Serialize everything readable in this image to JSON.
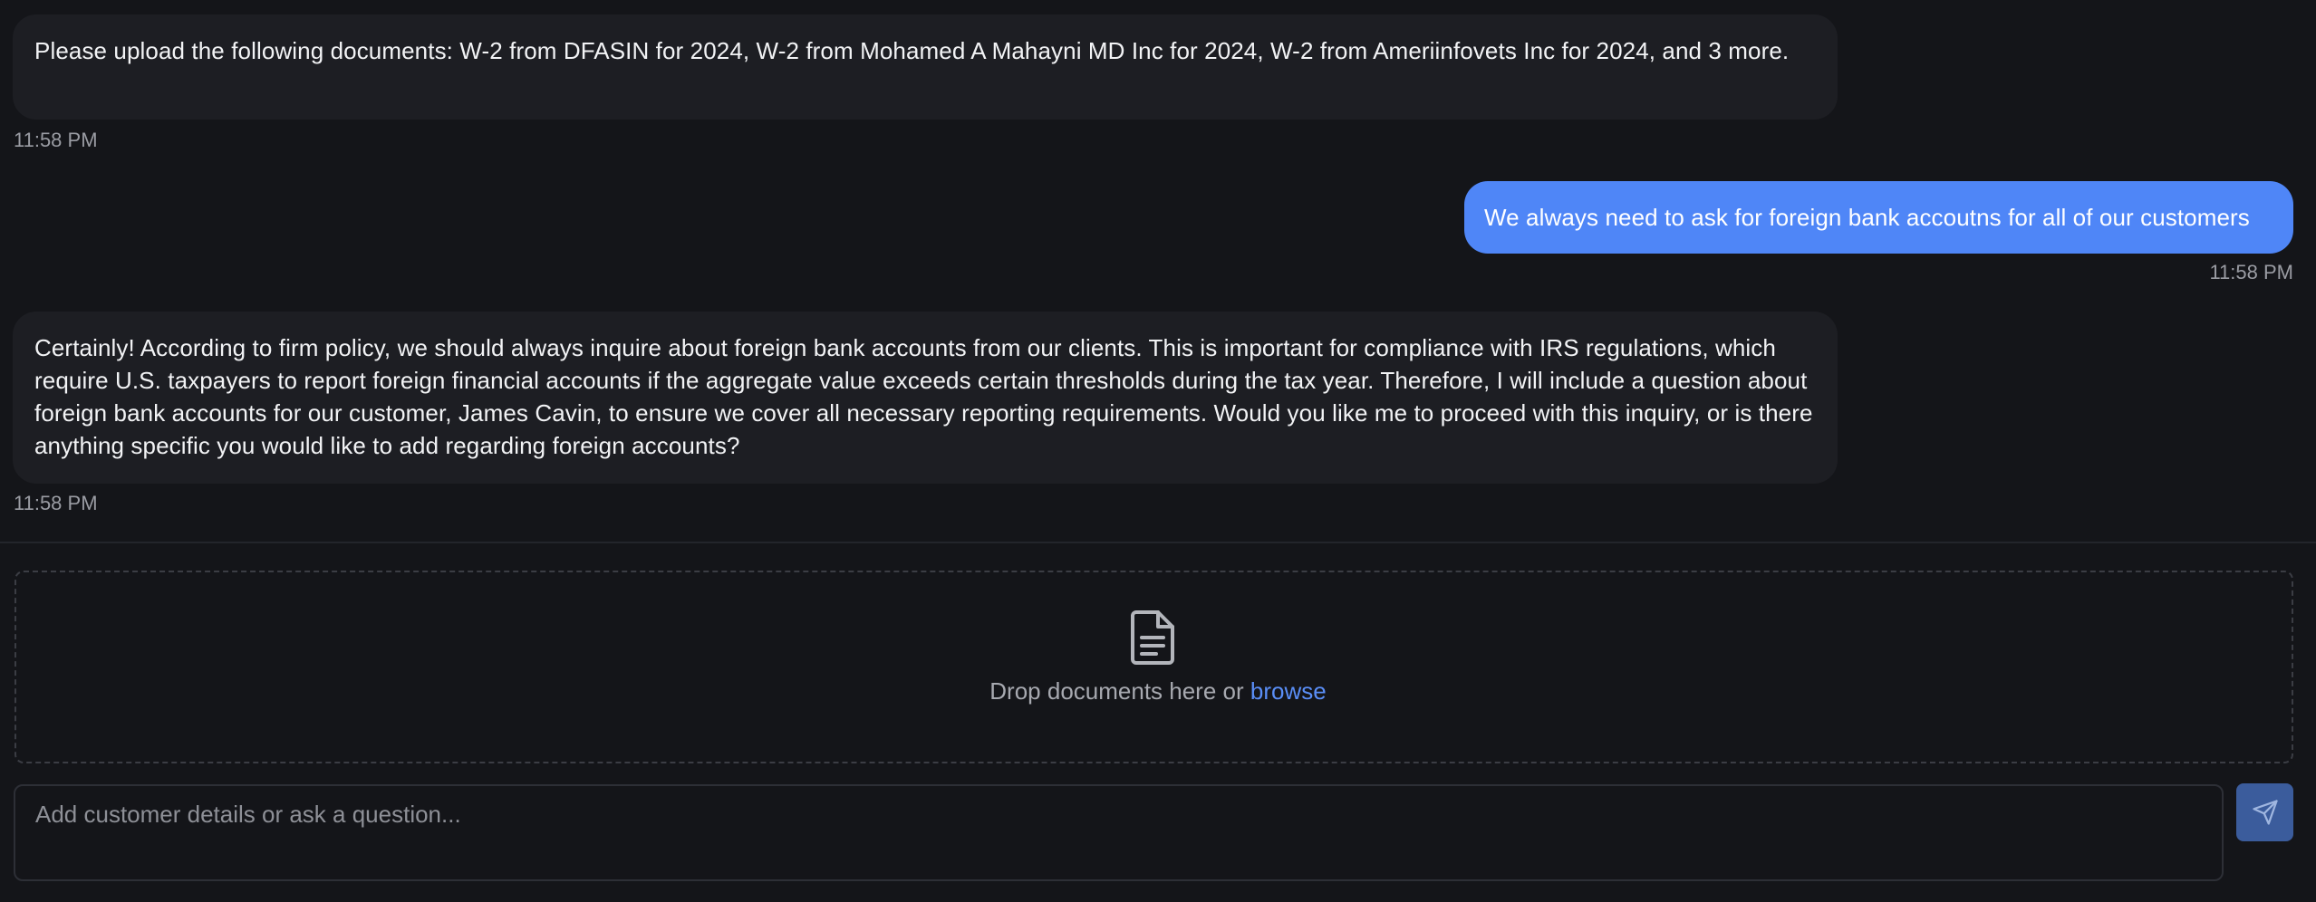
{
  "messages": [
    {
      "role": "assistant",
      "text": "Please upload the following documents: W-2 from DFASIN for 2024, W-2 from Mohamed A Mahayni MD Inc for 2024, W-2 from Ameriinfovets Inc for 2024, and 3 more.",
      "time": "11:58 PM"
    },
    {
      "role": "user",
      "text": "We always need to ask for foreign bank accoutns for all of our customers",
      "time": "11:58 PM"
    },
    {
      "role": "assistant",
      "text": "Certainly! According to firm policy, we should always inquire about foreign bank accounts from our clients. This is important for compliance with IRS regulations, which require U.S. taxpayers to report foreign financial accounts if the aggregate value exceeds certain thresholds during the tax year. Therefore, I will include a question about foreign bank accounts for our customer, James Cavin, to ensure we cover all necessary reporting requirements. Would you like me to proceed with this inquiry, or is there anything specific you would like to add regarding foreign accounts?",
      "time": "11:58 PM"
    }
  ],
  "dropzone": {
    "icon": "document-icon",
    "text": "Drop documents here or ",
    "browse_label": "browse"
  },
  "composer": {
    "placeholder": "Add customer details or ask a question...",
    "value": "",
    "send_icon": "send-icon"
  },
  "colors": {
    "background": "#141519",
    "assistant_bubble": "#1d1e23",
    "user_bubble": "#4f86f7",
    "accent_link": "#5a8ef7",
    "send_button": "#3b5c9c"
  }
}
